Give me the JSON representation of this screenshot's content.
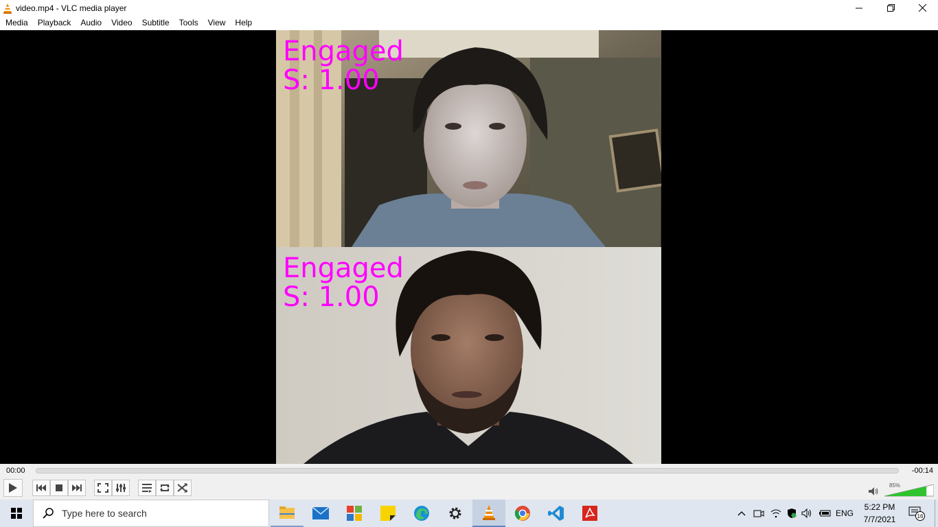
{
  "window": {
    "title": "video.mp4 - VLC media player"
  },
  "menu": [
    "Media",
    "Playback",
    "Audio",
    "Video",
    "Subtitle",
    "Tools",
    "View",
    "Help"
  ],
  "video": {
    "top_overlay": {
      "label": "Engaged",
      "score": "S: 1.00"
    },
    "bottom_overlay": {
      "label": "Engaged",
      "score": "S: 1.00"
    },
    "overlay_color": "#ff00ff"
  },
  "playback": {
    "elapsed": "00:00",
    "remaining": "-00:14",
    "progress": 0,
    "volume_label": "85%",
    "volume": 0.85
  },
  "taskbar": {
    "search_placeholder": "Type here to search",
    "apps": [
      "file-explorer",
      "mail",
      "office",
      "sticky-notes",
      "edge",
      "settings",
      "vlc",
      "chrome",
      "vscode",
      "acrobat"
    ],
    "language": "ENG",
    "time": "5:22 PM",
    "date": "7/7/2021",
    "notifications": "16"
  },
  "colors": {
    "taskbar_bg": "#dfe6ef",
    "controls_bg": "#f0f0f0",
    "vlc_orange": "#f08a00"
  }
}
